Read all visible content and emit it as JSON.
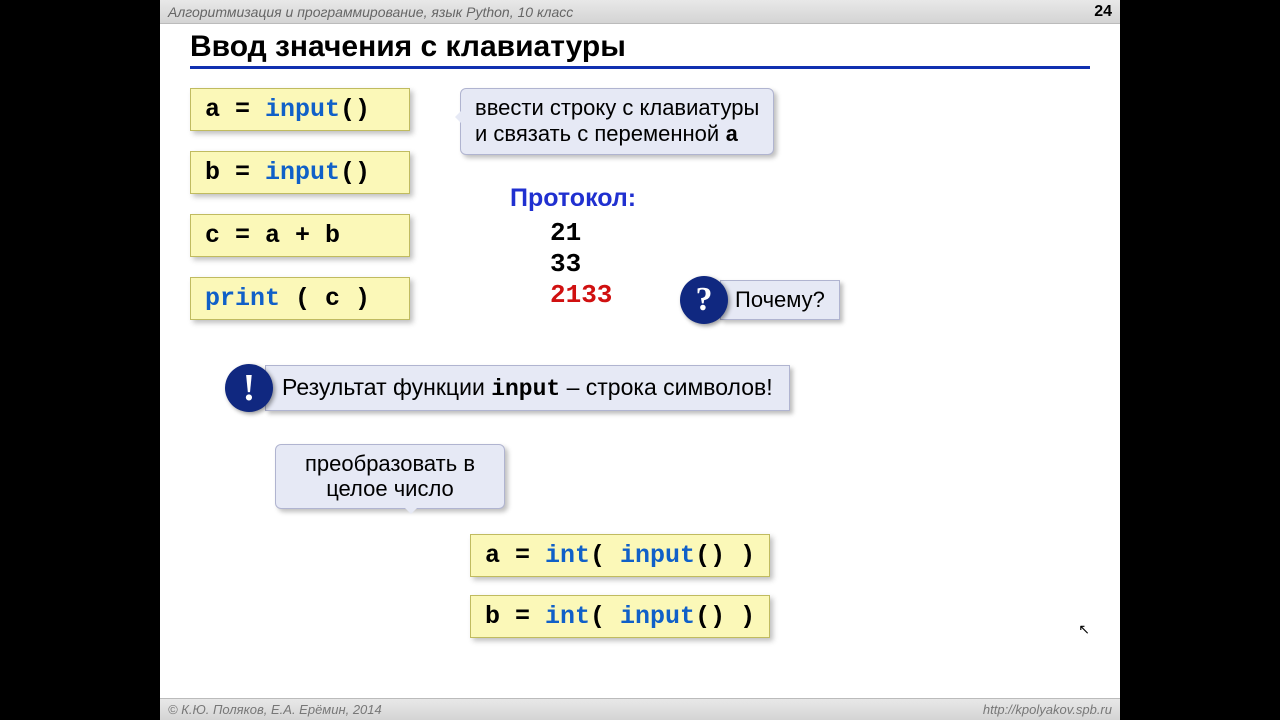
{
  "header": {
    "title": "Алгоритмизация и программирование, язык Python, 10 класс",
    "page": "24"
  },
  "footer": {
    "left": "© К.Ю. Поляков, Е.А. Ерёмин, 2014",
    "right": "http://kpolyakov.spb.ru"
  },
  "heading": "Ввод значения с клавиатуры",
  "code": {
    "a_eq": "a = ",
    "input_fn": "input",
    "paren": "()",
    "b_eq": "b = ",
    "c_line": "c = a + b",
    "print_fn": "print",
    "print_arg": " ( c )",
    "int_fn": "int",
    "int_open": "( ",
    "int_close": " )"
  },
  "bubble_input": {
    "line1": "ввести строку с клавиатуры",
    "line2": "и связать с переменной ",
    "var": "a"
  },
  "protocol": {
    "title": "Протокол:",
    "v1": "21",
    "v2": "33",
    "v3": "2133"
  },
  "question": "Почему?",
  "result": {
    "t1": "Результат функции ",
    "fn": "input",
    "t2": " – строка символов!"
  },
  "convert": {
    "line1": "преобразовать в",
    "line2": "целое число"
  }
}
